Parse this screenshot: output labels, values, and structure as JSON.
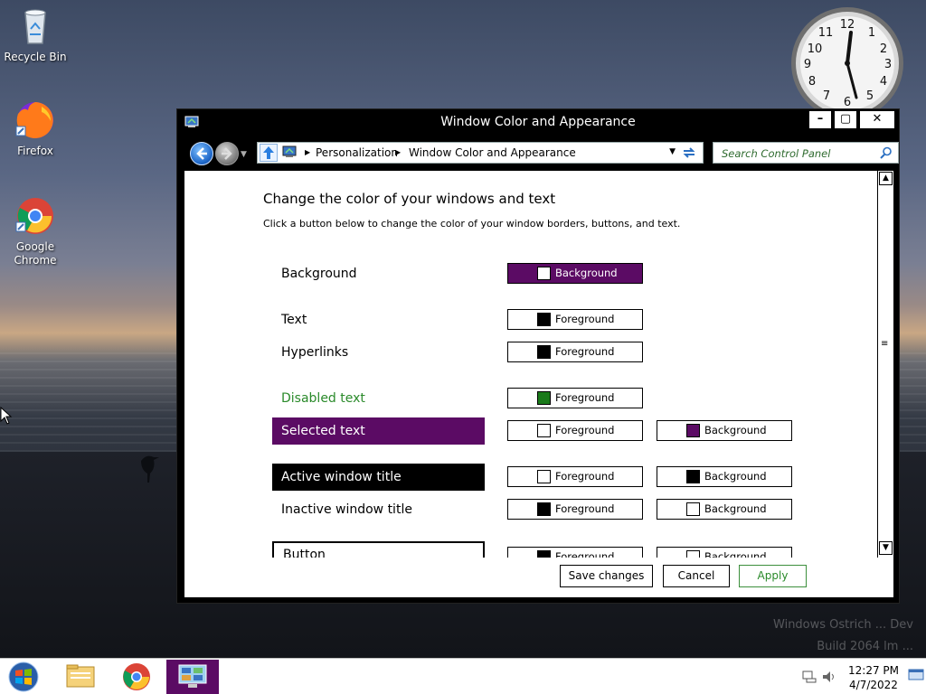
{
  "desktop": {
    "icons": [
      {
        "label": "Recycle Bin",
        "icon": "recycle-bin-icon"
      },
      {
        "label": "Firefox",
        "icon": "firefox-icon"
      },
      {
        "label": "Google\nChrome",
        "icon": "chrome-icon"
      }
    ],
    "watermark": {
      "line1": "Windows Ostrich ... Dev",
      "line2": "Build 2064 lm ..."
    }
  },
  "window": {
    "title": "Window Color and Appearance",
    "controls": {
      "minimize": "–",
      "maximize": "▢",
      "close": "✕"
    },
    "nav": {
      "breadcrumb": [
        "Personalization",
        "Window Color and Appearance"
      ],
      "search_placeholder": "Search Control Panel"
    },
    "heading": "Change the color of your windows and text",
    "subheading": "Click a button below to change the color of your window borders, buttons, and text.",
    "rows": [
      {
        "label": "Background",
        "fg": {
          "label": "Background",
          "swatch": "#ffffff"
        },
        "bg": null
      },
      {
        "label": "Text",
        "fg": {
          "label": "Foreground",
          "swatch": "#000000"
        },
        "bg": null
      },
      {
        "label": "Hyperlinks",
        "fg": {
          "label": "Foreground",
          "swatch": "#000000"
        },
        "bg": null
      },
      {
        "label": "Disabled text",
        "fg": {
          "label": "Foreground",
          "swatch": "#1a7a1a"
        },
        "bg": null
      },
      {
        "label": "Selected text",
        "fg": {
          "label": "Foreground",
          "swatch": "#ffffff"
        },
        "bg": {
          "label": "Background",
          "swatch": "#5b0b64"
        }
      },
      {
        "label": "Active window title",
        "fg": {
          "label": "Foreground",
          "swatch": "#ffffff"
        },
        "bg": {
          "label": "Background",
          "swatch": "#000000"
        }
      },
      {
        "label": "Inactive window title",
        "fg": {
          "label": "Foreground",
          "swatch": "#000000"
        },
        "bg": {
          "label": "Background",
          "swatch": "#ffffff"
        }
      },
      {
        "label": "Button",
        "fg": {
          "label": "Foreground",
          "swatch": "#000000"
        },
        "bg": {
          "label": "Background",
          "swatch": "#ffffff"
        }
      }
    ],
    "actions": {
      "save": "Save changes",
      "cancel": "Cancel",
      "apply": "Apply"
    }
  },
  "taskbar": {
    "time": "12:27 PM",
    "date": "4/7/2022",
    "items": [
      "file-explorer-icon",
      "chrome-icon",
      "control-panel-icon"
    ]
  },
  "colors": {
    "accent_purple": "#5b0b64",
    "disabled_green": "#2a8a2a"
  }
}
